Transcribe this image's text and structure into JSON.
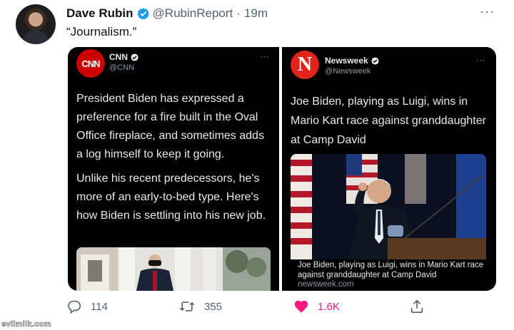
{
  "tweet": {
    "author_name": "Dave Rubin",
    "handle": "@RubinReport",
    "separator": "·",
    "time": "19m",
    "text": "“Journalism.”",
    "more": "···"
  },
  "cards": {
    "cnn": {
      "logo": "CNN",
      "name": "CNN",
      "handle": "@CNN",
      "more": "···",
      "paragraph1": "President Biden has expressed a preference for a fire built in the Oval Office fireplace, and sometimes adds a log himself to keep it going.",
      "paragraph2": "Unlike his recent predecessors, he's more of an early-to-bed type. Here's how Biden is settling into his new job."
    },
    "newsweek": {
      "logo": "N",
      "name": "Newsweek",
      "handle": "@Newsweek",
      "more": "···",
      "headline": "Joe Biden, playing as Luigi, wins in Mario Kart race against granddaughter at Camp David",
      "caption": "Joe Biden, playing as Luigi, wins in Mario Kart race against granddaughter at Camp David",
      "domain": "newsweek.com"
    }
  },
  "actions": {
    "replies": "114",
    "retweets": "355",
    "likes": "1.6K"
  },
  "watermark": "evilmilk.com",
  "colors": {
    "verified": "#1d9bf0",
    "like": "#f91880",
    "cnn_red": "#cc0000",
    "newsweek_red": "#e2231a"
  },
  "icons": [
    "verified-badge-icon",
    "more-icon",
    "reply-icon",
    "retweet-icon",
    "like-icon",
    "share-icon"
  ]
}
